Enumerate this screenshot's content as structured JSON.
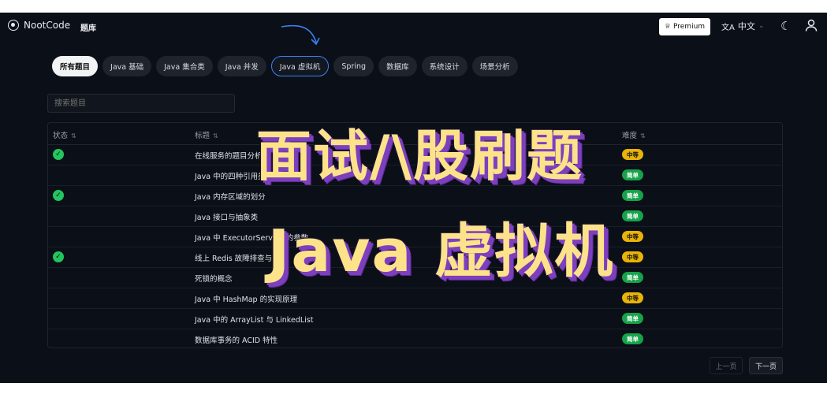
{
  "header": {
    "logo_text": "NootCode",
    "nav_link": "题库",
    "premium_label": "Premium",
    "language": "中文"
  },
  "tabs": [
    {
      "label": "所有题目",
      "state": "active"
    },
    {
      "label": "Java 基础",
      "state": "normal"
    },
    {
      "label": "Java 集合类",
      "state": "normal"
    },
    {
      "label": "Java 并发",
      "state": "normal"
    },
    {
      "label": "Java 虚拟机",
      "state": "outlined"
    },
    {
      "label": "Spring",
      "state": "normal"
    },
    {
      "label": "数据库",
      "state": "normal"
    },
    {
      "label": "系统设计",
      "state": "normal"
    },
    {
      "label": "场景分析",
      "state": "normal"
    }
  ],
  "search": {
    "placeholder": "搜索题目"
  },
  "table": {
    "headers": {
      "status": "状态",
      "title": "标题",
      "difficulty": "难度",
      "sort_glyph": "⇅"
    },
    "rows": [
      {
        "done": true,
        "title": "在线服务的题目分析",
        "difficulty": "中等",
        "level": "medium"
      },
      {
        "done": false,
        "title": "Java 中的四种引用类型",
        "difficulty": "简单",
        "level": "easy"
      },
      {
        "done": true,
        "title": "Java 内存区域的划分",
        "difficulty": "简单",
        "level": "easy"
      },
      {
        "done": false,
        "title": "Java 接口与抽象类",
        "difficulty": "简单",
        "level": "easy"
      },
      {
        "done": false,
        "title": "Java 中 ExecutorService 的参数",
        "difficulty": "中等",
        "level": "medium"
      },
      {
        "done": true,
        "title": "线上 Redis 故障排查与优化",
        "difficulty": "中等",
        "level": "medium"
      },
      {
        "done": false,
        "title": "死锁的概念",
        "difficulty": "简单",
        "level": "easy"
      },
      {
        "done": false,
        "title": "Java 中 HashMap 的实现原理",
        "difficulty": "中等",
        "level": "medium"
      },
      {
        "done": false,
        "title": "Java 中的 ArrayList 与 LinkedList",
        "difficulty": "简单",
        "level": "easy"
      },
      {
        "done": false,
        "title": "数据库事务的 ACID 特性",
        "difficulty": "简单",
        "level": "easy"
      }
    ]
  },
  "pagination": {
    "prev": "上一页",
    "next": "下一页"
  },
  "overlay": {
    "line1": "面试/\\股刷题",
    "line2": "Java 虚拟机"
  },
  "colors": {
    "accent_blue": "#3b82f6",
    "easy": "#16a34a",
    "medium": "#eab308",
    "overlay_text": "#fce38a",
    "overlay_shadow": "#7e3fbf"
  }
}
